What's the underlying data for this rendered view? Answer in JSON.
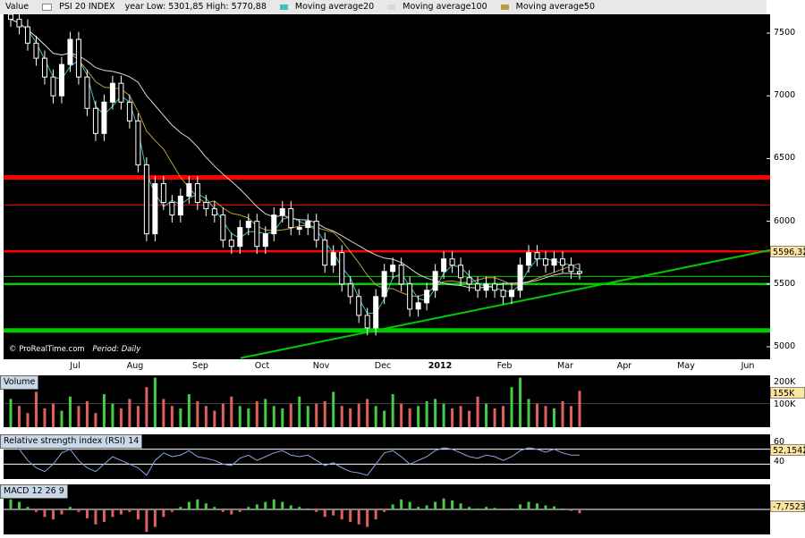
{
  "legend": {
    "value_label": "Value",
    "series_name": "PSI 20 INDEX",
    "range_text": "year Low: 5301,85 High: 5770,88",
    "ma20": "Moving average20",
    "ma100": "Moving average100",
    "ma50": "Moving average50",
    "colors": {
      "price": "#ffffff",
      "ma20": "#3fc0c0",
      "ma100": "#d8d8d8",
      "ma50": "#b8a040"
    }
  },
  "footer": {
    "source": "© ProRealTime.com",
    "period": "Period: Daily"
  },
  "volume_panel": {
    "label": "Volume",
    "ticks": [
      "200K",
      "100K"
    ],
    "last": "155K"
  },
  "rsi_panel": {
    "label": "Relative strength index (RSI) 14",
    "ticks": [
      "60",
      "40"
    ],
    "last": "52,1542"
  },
  "macd_panel": {
    "label": "MACD 12 26 9",
    "last": "-7,7523"
  },
  "chart_data": {
    "type": "candlestick",
    "title": "PSI 20 INDEX",
    "period": "Daily",
    "x_labels": [
      "Jul",
      "Aug",
      "Sep",
      "Oct",
      "Nov",
      "Dec",
      "2012",
      "Feb",
      "Mar",
      "Apr",
      "May",
      "Jun"
    ],
    "y_ticks": [
      "7500",
      "7000",
      "6500",
      "6000",
      "5500",
      "5000"
    ],
    "ylim": [
      4900,
      7650
    ],
    "last_value": "5596,32",
    "close_series": [
      7610,
      7550,
      7420,
      7300,
      7150,
      7000,
      7250,
      7450,
      7150,
      6900,
      6700,
      6950,
      7100,
      6950,
      6800,
      6450,
      5900,
      6300,
      6150,
      6050,
      6200,
      6300,
      6150,
      6100,
      6050,
      5850,
      5800,
      5950,
      6000,
      5800,
      5900,
      6050,
      6100,
      5950,
      5950,
      6000,
      5850,
      5650,
      5750,
      5500,
      5400,
      5250,
      5150,
      5400,
      5600,
      5650,
      5500,
      5300,
      5350,
      5450,
      5600,
      5700,
      5650,
      5550,
      5500,
      5450,
      5500,
      5450,
      5400,
      5450,
      5650,
      5750,
      5700,
      5650,
      5700,
      5650,
      5600,
      5596
    ],
    "horizontal_levels": [
      {
        "value": 6350,
        "color": "#ff0000",
        "style": "thick"
      },
      {
        "value": 6130,
        "color": "#ff0000",
        "style": "thin"
      },
      {
        "value": 5760,
        "color": "#ff0000",
        "style": "medium"
      },
      {
        "value": 5560,
        "color": "#00cc00",
        "style": "thin"
      },
      {
        "value": 5500,
        "color": "#00cc00",
        "style": "medium"
      },
      {
        "value": 5130,
        "color": "#00cc00",
        "style": "thick"
      }
    ],
    "trendline": {
      "from": [
        "Sep",
        4910
      ],
      "to": [
        "Jun",
        5770
      ],
      "color": "#00cc00"
    },
    "volume": [
      120,
      90,
      60,
      150,
      80,
      100,
      70,
      130,
      90,
      110,
      60,
      140,
      100,
      80,
      120,
      90,
      170,
      210,
      120,
      90,
      80,
      140,
      110,
      90,
      70,
      100,
      130,
      90,
      80,
      110,
      120,
      90,
      80,
      100,
      130,
      90,
      100,
      110,
      150,
      90,
      80,
      100,
      120,
      90,
      70,
      140,
      100,
      80,
      90,
      110,
      120,
      100,
      80,
      90,
      70,
      130,
      100,
      80,
      90,
      170,
      210,
      120,
      100,
      90,
      80,
      110,
      90,
      155
    ],
    "volume_ylim": [
      0,
      220
    ],
    "rsi": [
      70,
      60,
      45,
      35,
      30,
      40,
      55,
      60,
      45,
      35,
      30,
      40,
      50,
      45,
      40,
      35,
      25,
      45,
      55,
      50,
      52,
      58,
      50,
      48,
      45,
      40,
      38,
      48,
      52,
      45,
      50,
      55,
      58,
      52,
      50,
      52,
      45,
      38,
      42,
      35,
      30,
      28,
      25,
      40,
      55,
      58,
      50,
      40,
      45,
      50,
      58,
      62,
      60,
      55,
      50,
      48,
      52,
      50,
      45,
      50,
      58,
      62,
      60,
      56,
      60,
      55,
      52,
      52
    ],
    "rsi_ylim": [
      20,
      80
    ],
    "macd": [
      20,
      15,
      5,
      -5,
      -15,
      -20,
      -10,
      5,
      -5,
      -18,
      -30,
      -25,
      -15,
      -10,
      -5,
      -20,
      -45,
      -35,
      -15,
      -5,
      5,
      15,
      20,
      12,
      5,
      -5,
      -10,
      -5,
      5,
      10,
      15,
      20,
      15,
      8,
      5,
      2,
      -5,
      -15,
      -12,
      -20,
      -25,
      -30,
      -35,
      -20,
      -5,
      10,
      20,
      15,
      5,
      8,
      15,
      22,
      18,
      12,
      5,
      2,
      5,
      3,
      -2,
      2,
      10,
      15,
      12,
      8,
      6,
      2,
      -3,
      -7.75
    ],
    "macd_ylim": [
      -50,
      50
    ]
  }
}
